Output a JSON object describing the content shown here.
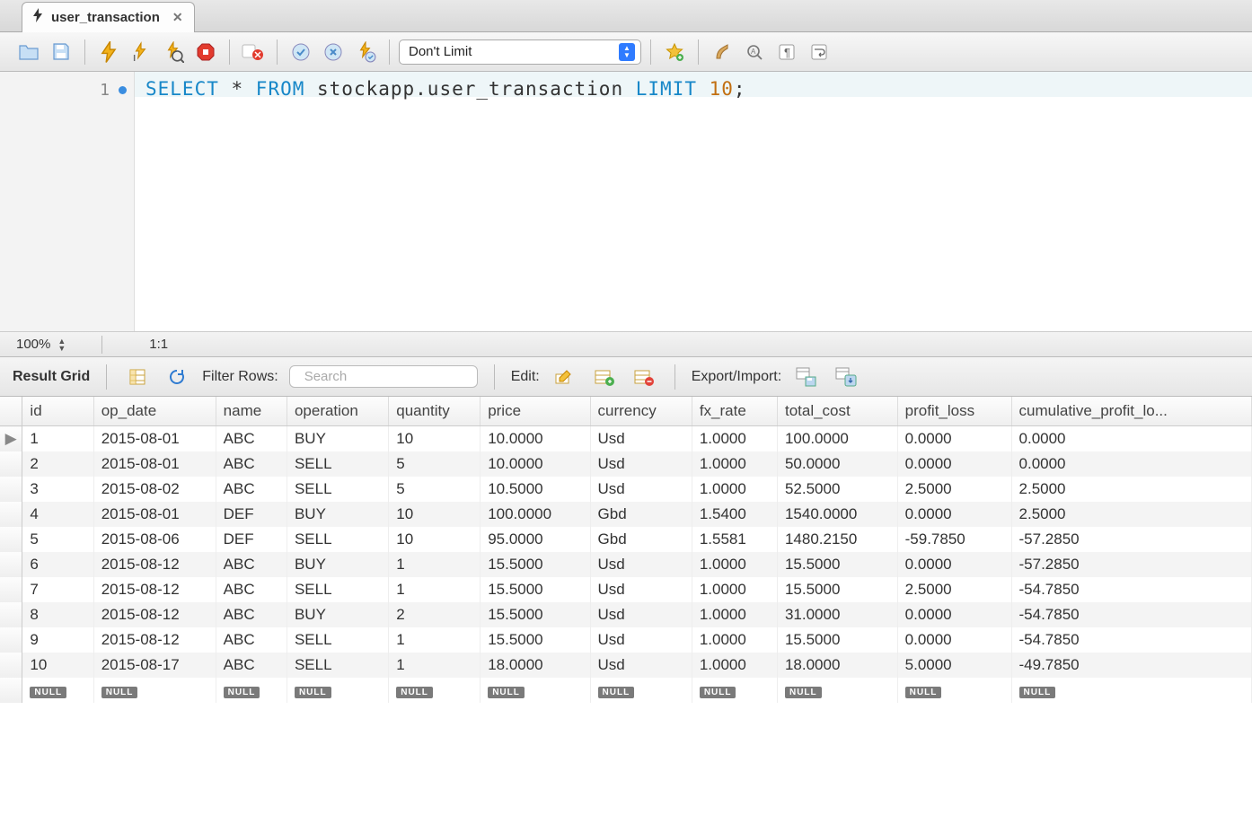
{
  "tab": {
    "title": "user_transaction"
  },
  "toolbar": {
    "limit_label": "Don't Limit"
  },
  "editor": {
    "zoom": "100%",
    "position": "1:1",
    "line_number": "1",
    "sql": {
      "select": "SELECT",
      "star": " * ",
      "from": "FROM",
      "table": " stockapp.user_transaction ",
      "limit": "LIMIT",
      "count": "10",
      "semi": ";"
    }
  },
  "result_bar": {
    "label": "Result Grid",
    "filter_label": "Filter Rows:",
    "search_placeholder": "Search",
    "edit_label": "Edit:",
    "export_label": "Export/Import:"
  },
  "table": {
    "columns": [
      "id",
      "op_date",
      "name",
      "operation",
      "quantity",
      "price",
      "currency",
      "fx_rate",
      "total_cost",
      "profit_loss",
      "cumulative_profit_lo..."
    ],
    "rows": [
      [
        "1",
        "2015-08-01",
        "ABC",
        "BUY",
        "10",
        "10.0000",
        "Usd",
        "1.0000",
        "100.0000",
        "0.0000",
        "0.0000"
      ],
      [
        "2",
        "2015-08-01",
        "ABC",
        "SELL",
        "5",
        "10.0000",
        "Usd",
        "1.0000",
        "50.0000",
        "0.0000",
        "0.0000"
      ],
      [
        "3",
        "2015-08-02",
        "ABC",
        "SELL",
        "5",
        "10.5000",
        "Usd",
        "1.0000",
        "52.5000",
        "2.5000",
        "2.5000"
      ],
      [
        "4",
        "2015-08-01",
        "DEF",
        "BUY",
        "10",
        "100.0000",
        "Gbd",
        "1.5400",
        "1540.0000",
        "0.0000",
        "2.5000"
      ],
      [
        "5",
        "2015-08-06",
        "DEF",
        "SELL",
        "10",
        "95.0000",
        "Gbd",
        "1.5581",
        "1480.2150",
        "-59.7850",
        "-57.2850"
      ],
      [
        "6",
        "2015-08-12",
        "ABC",
        "BUY",
        "1",
        "15.5000",
        "Usd",
        "1.0000",
        "15.5000",
        "0.0000",
        "-57.2850"
      ],
      [
        "7",
        "2015-08-12",
        "ABC",
        "SELL",
        "1",
        "15.5000",
        "Usd",
        "1.0000",
        "15.5000",
        "2.5000",
        "-54.7850"
      ],
      [
        "8",
        "2015-08-12",
        "ABC",
        "BUY",
        "2",
        "15.5000",
        "Usd",
        "1.0000",
        "31.0000",
        "0.0000",
        "-54.7850"
      ],
      [
        "9",
        "2015-08-12",
        "ABC",
        "SELL",
        "1",
        "15.5000",
        "Usd",
        "1.0000",
        "15.5000",
        "0.0000",
        "-54.7850"
      ],
      [
        "10",
        "2015-08-17",
        "ABC",
        "SELL",
        "1",
        "18.0000",
        "Usd",
        "1.0000",
        "18.0000",
        "5.0000",
        "-49.7850"
      ]
    ],
    "null_label": "NULL"
  }
}
